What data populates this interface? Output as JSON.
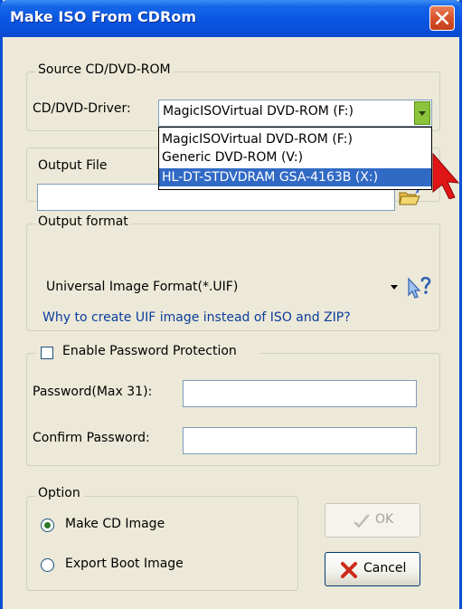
{
  "window": {
    "title": "Make ISO From CDRom"
  },
  "source_group": {
    "label": "Source CD/DVD-ROM",
    "driver_label": "CD/DVD-Driver:",
    "driver_selected": "MagicISOVirtual DVD-ROM  (F:)",
    "driver_options": [
      "MagicISOVirtual DVD-ROM  (F:)",
      "Generic DVD-ROM           (V:)",
      "HL-DT-STDVDRAM GSA-4163B (X:)"
    ],
    "highlighted_option_index": 2
  },
  "output_file_group": {
    "label": "Output File",
    "value": ""
  },
  "output_format_group": {
    "label": "Output format",
    "format_selected": "Universal Image Format(*.UIF)",
    "help_link": "Why to create UIF image instead of ISO and ZIP?"
  },
  "password_group": {
    "enable_label": "Enable Password Protection",
    "enabled": false,
    "password_label": "Password(Max 31):",
    "confirm_label": "Confirm Password:",
    "password_value": "",
    "confirm_value": ""
  },
  "option_group": {
    "label": "Option",
    "make_cd_label": "Make CD Image",
    "export_boot_label": "Export Boot Image",
    "selected": "make_cd"
  },
  "buttons": {
    "ok_label": "OK",
    "ok_enabled": false,
    "cancel_label": "Cancel"
  },
  "colors": {
    "title_bar": "#0a54e0",
    "selection": "#316ac5",
    "link": "#0b3d9c",
    "cancel_x": "#cc2a1a",
    "cursor": "#e01515"
  }
}
